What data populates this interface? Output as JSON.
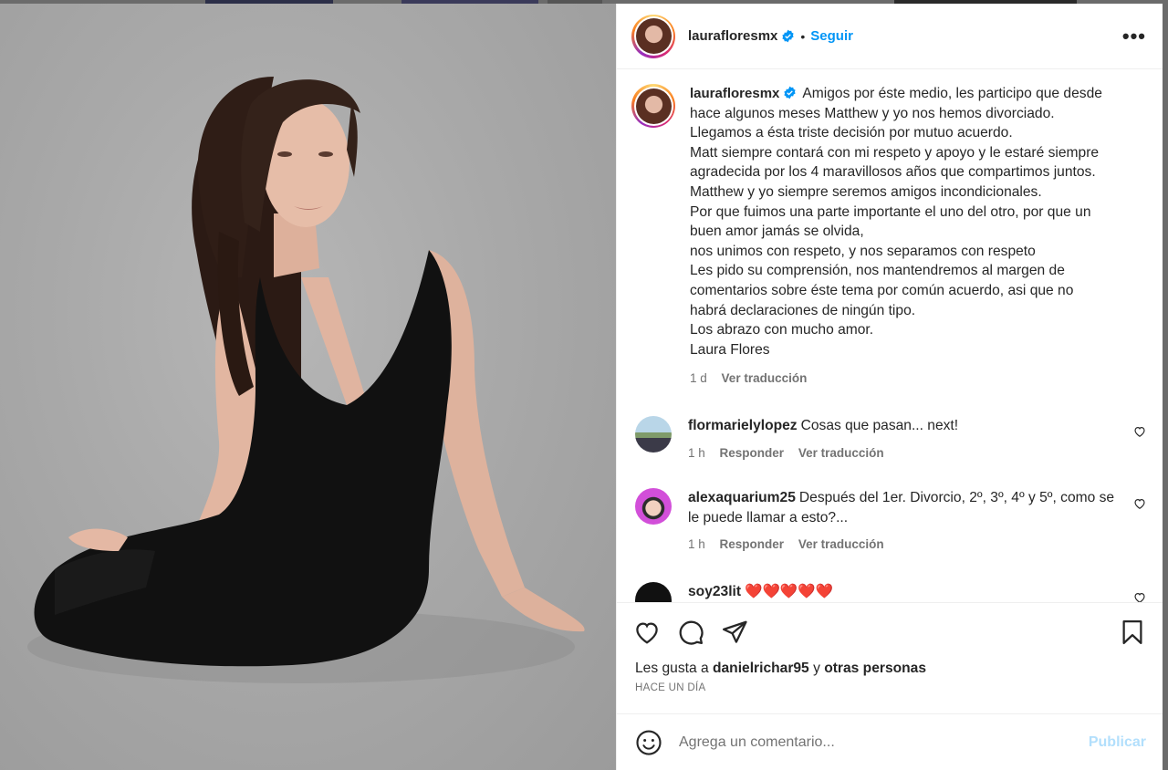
{
  "colors": {
    "accent": "#0095f6",
    "heart": "#ed4956",
    "muted": "#737373"
  },
  "post": {
    "username": "laurafloresmx",
    "verified": true,
    "follow_label": "Seguir",
    "more_label": "•••",
    "caption_lines": [
      "Amigos por éste medio, les participo que desde",
      "hace algunos meses Matthew y yo nos hemos divorciado.",
      "Llegamos a ésta triste decisión por mutuo acuerdo.",
      "Matt siempre contará con mi respeto y apoyo y le estaré siempre",
      "agradecida por los 4 maravillosos años que compartimos juntos.",
      "Matthew y yo siempre seremos amigos incondicionales.",
      "Por que fuimos una parte importante el uno del otro, por que un",
      "buen amor jamás se olvida,",
      "nos unimos con respeto, y nos separamos con respeto",
      "Les pido su comprensión, nos mantendremos al margen de",
      "comentarios sobre éste tema por común acuerdo, asi que no",
      "habrá declaraciones de ningún tipo.",
      "Los abrazo con mucho amor.",
      "Laura Flores"
    ],
    "caption_time": "1 d",
    "translate_label": "Ver traducción"
  },
  "comments": [
    {
      "username": "flormarielylopez",
      "text": "Cosas que pasan... next!",
      "time": "1 h",
      "reply_label": "Responder",
      "translate_label": "Ver traducción"
    },
    {
      "username": "alexaquarium25",
      "text": "Después del 1er. Divorcio, 2º, 3º, 4º y 5º, como se le puede llamar a esto?...",
      "time": "1 h",
      "reply_label": "Responder",
      "translate_label": "Ver traducción"
    },
    {
      "username": "soy23lit",
      "text": "❤️❤️❤️❤️❤️"
    }
  ],
  "icons": {
    "like": "heart-icon",
    "comment": "comment-icon",
    "share": "send-icon",
    "save": "bookmark-icon",
    "emoji": "emoji-icon",
    "more": "more-options-icon",
    "verified": "verified-badge-icon"
  },
  "likes": {
    "prefix": "Les gusta a",
    "user": "danielrichar95",
    "joiner": "y",
    "others": "otras personas"
  },
  "post_age": "HACE UN DÍA",
  "add_comment": {
    "placeholder": "Agrega un comentario...",
    "publish_label": "Publicar"
  }
}
